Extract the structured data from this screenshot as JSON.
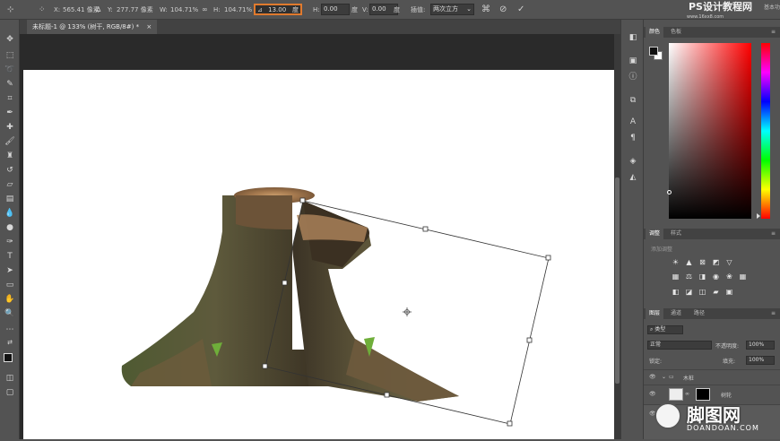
{
  "options_bar": {
    "x_label": "X:",
    "x_value": "565.41 像素",
    "y_label": "Y:",
    "y_value": "277.77 像素",
    "w_label": "W:",
    "w_value": "104.71%",
    "h_label": "H:",
    "h_value": "104.71%",
    "angle_value": "13.00",
    "angle_unit": "度",
    "hskew_label": "H:",
    "hskew_value": "0.00",
    "hskew_unit": "度",
    "vskew_label": "V:",
    "vskew_value": "0.00",
    "vskew_unit": "度",
    "interp_label": "插值:",
    "interp_value": "两次立方",
    "watermark": "PS设计教程网",
    "watermark_url": "www.16xx8.com",
    "top_right": "基本功"
  },
  "document": {
    "tab_title": "未标题-1 @ 133% (树干, RGB/8#) *",
    "close": "×"
  },
  "color_panel": {
    "tab_color": "颜色",
    "tab_swatches": "色板"
  },
  "adjust_panel": {
    "tab_adjust": "调整",
    "tab_styles": "样式",
    "add_label": "添加调整"
  },
  "layers_panel": {
    "tab_layers": "图层",
    "tab_channels": "通道",
    "tab_paths": "路径",
    "kind_placeholder": "类型",
    "blend_mode": "正常",
    "opacity_label": "不透明度:",
    "opacity_value": "100%",
    "lock_label": "锁定:",
    "fill_label": "填充:",
    "fill_value": "100%",
    "group_name": "木桩",
    "layer_name": "树轮"
  },
  "site_watermark": {
    "brand": "脚图网",
    "url": "DOANDOAN.COM"
  }
}
